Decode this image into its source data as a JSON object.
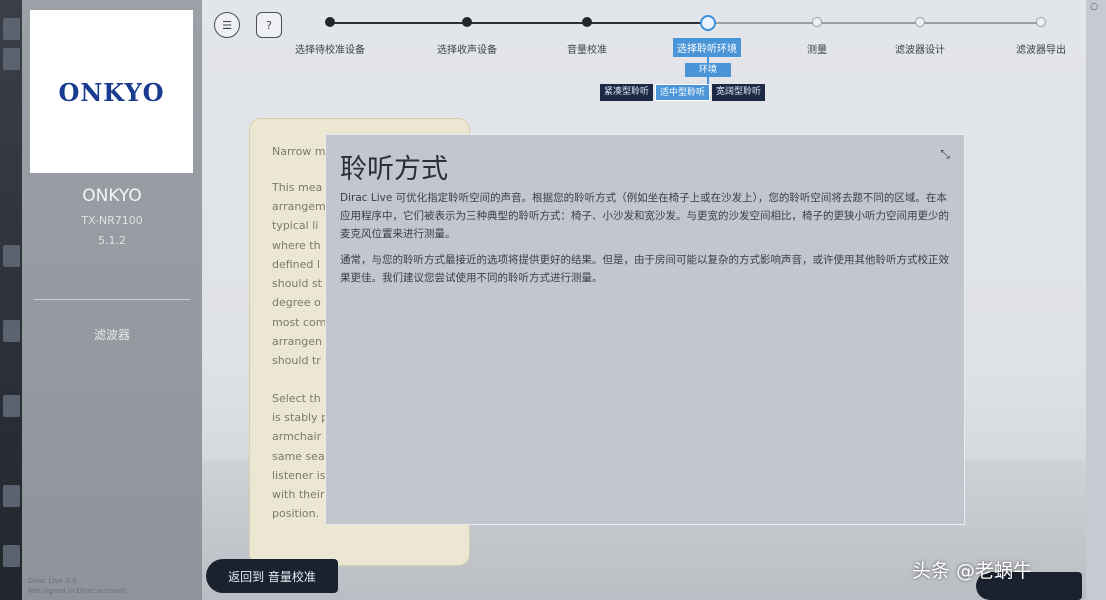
{
  "sidebar": {
    "logo_text": "ONKYO",
    "brand": "ONKYO",
    "model": "TX-NR7100",
    "channels": "5.1.2",
    "section": "滤波器",
    "footer_line1": "Dirac Live 3.3",
    "footer_line2": "Not signed in Dirac account"
  },
  "toolbar": {
    "menu_icon": "☰",
    "help_icon": "?"
  },
  "stepper": {
    "steps": [
      {
        "label": "选择待校准设备"
      },
      {
        "label": "选择收声设备"
      },
      {
        "label": "音量校准"
      },
      {
        "label": "选择聆听环境"
      },
      {
        "label": "测量"
      },
      {
        "label": "滤波器设计"
      },
      {
        "label": "滤波器导出"
      }
    ],
    "sub_tag": "环境",
    "sub_options": [
      "紧凑型聆听",
      "适中型聆听",
      "宽阔型聆听"
    ]
  },
  "back_card": {
    "title": "Narrow m",
    "lines": [
      "This mea",
      "arrangem",
      "typical li",
      "where th",
      "defined l",
      "should st",
      "degree o",
      "most com",
      "arrangen",
      "should tr",
      "",
      "Select th",
      "is stably p",
      "armchair",
      "same sea",
      "listener is",
      "with their",
      "position."
    ]
  },
  "dialog": {
    "title": "聆听方式",
    "para1": "Dirac Live 可优化指定聆听空间的声音。根据您的聆听方式（例如坐在椅子上或在沙发上），您的聆听空间将去题不同的区域。在本应用程序中，它们被表示为三种典型的聆听方式：椅子、小沙发和宽沙发。与更宽的沙发空间相比，椅子的更狭小听力空间用更少的麦克风位置来进行测量。",
    "para2": "通常，与您的聆听方式最接近的选项将提供更好的结果。但是，由于房间可能以复杂的方式影响声音，或许使用其他聆听方式校正效果更佳。我们建议您尝试使用不同的聆听方式进行测量。"
  },
  "buttons": {
    "back": "返回到 音量校准"
  },
  "watermark": "头条 @老蜗牛",
  "window_controls": "○"
}
